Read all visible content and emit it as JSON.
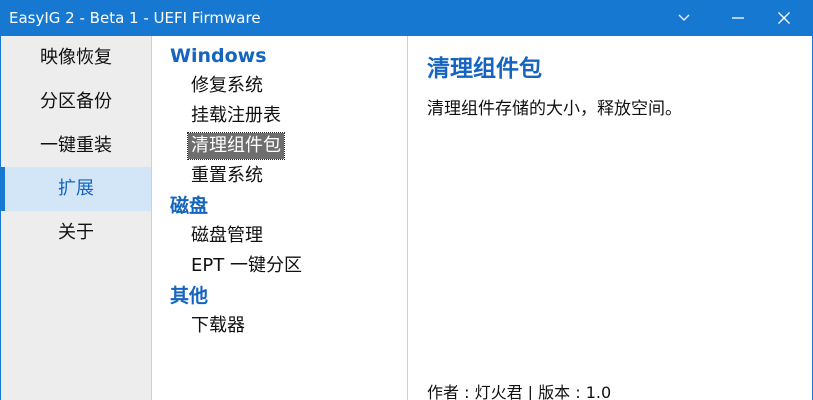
{
  "window": {
    "title": "EasyIG 2 - Beta 1 - UEFI Firmware",
    "controls": [
      "chevron-down-icon",
      "minimize-icon",
      "close-icon"
    ]
  },
  "sidebar": {
    "items": [
      {
        "label": "映像恢复"
      },
      {
        "label": "分区备份"
      },
      {
        "label": "一键重装"
      },
      {
        "label": "扩展",
        "active": true
      },
      {
        "label": "关于"
      }
    ]
  },
  "tree": {
    "categories": [
      {
        "label": "Windows",
        "items": [
          "修复系统",
          "挂载注册表",
          "清理组件包",
          "重置系统"
        ]
      },
      {
        "label": "磁盘",
        "items": [
          "磁盘管理",
          "EPT 一键分区"
        ]
      },
      {
        "label": "其他",
        "items": [
          "下载器"
        ]
      }
    ],
    "selected": "清理组件包"
  },
  "detail": {
    "title": "清理组件包",
    "description": "清理组件存储的大小，释放空间。",
    "footer": "作者 : 灯火君 | 版本 : 1.0"
  },
  "colors": {
    "accent": "#1778d2",
    "category_text": "#1565c0",
    "sidebar_bg": "#ededed",
    "sidebar_active_bg": "#d3e6f8",
    "selected_bg": "#6e6e6e"
  }
}
